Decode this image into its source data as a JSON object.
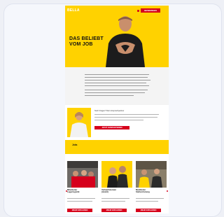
{
  "site": {
    "logo": "BELLA",
    "top_button": "BEWERBEN"
  },
  "hero": {
    "title_line1": "DAS BELIEBT",
    "title_line2": "VOM JOB"
  },
  "contact": {
    "title": "Noch Fragen? Dein Ansprechpartner",
    "button": "JETZT KONTAKTIEREN"
  },
  "jobs": {
    "label": "Jobs",
    "cards": [
      {
        "title_line1": "Mitarbeiter",
        "title_line2": "Lagerlogistik",
        "button": "MEHR ERFAHREN"
      },
      {
        "title_line1": "Verkaufsberater",
        "title_line2": "(m/w/d)",
        "button": "MEHR ERFAHREN"
      },
      {
        "title_line1": "Marktleiter",
        "title_line2": "Stellvertretung",
        "button": "MEHR ERFAHREN"
      }
    ]
  },
  "colors": {
    "brand_yellow": "#ffd200",
    "brand_red": "#d6001c"
  }
}
